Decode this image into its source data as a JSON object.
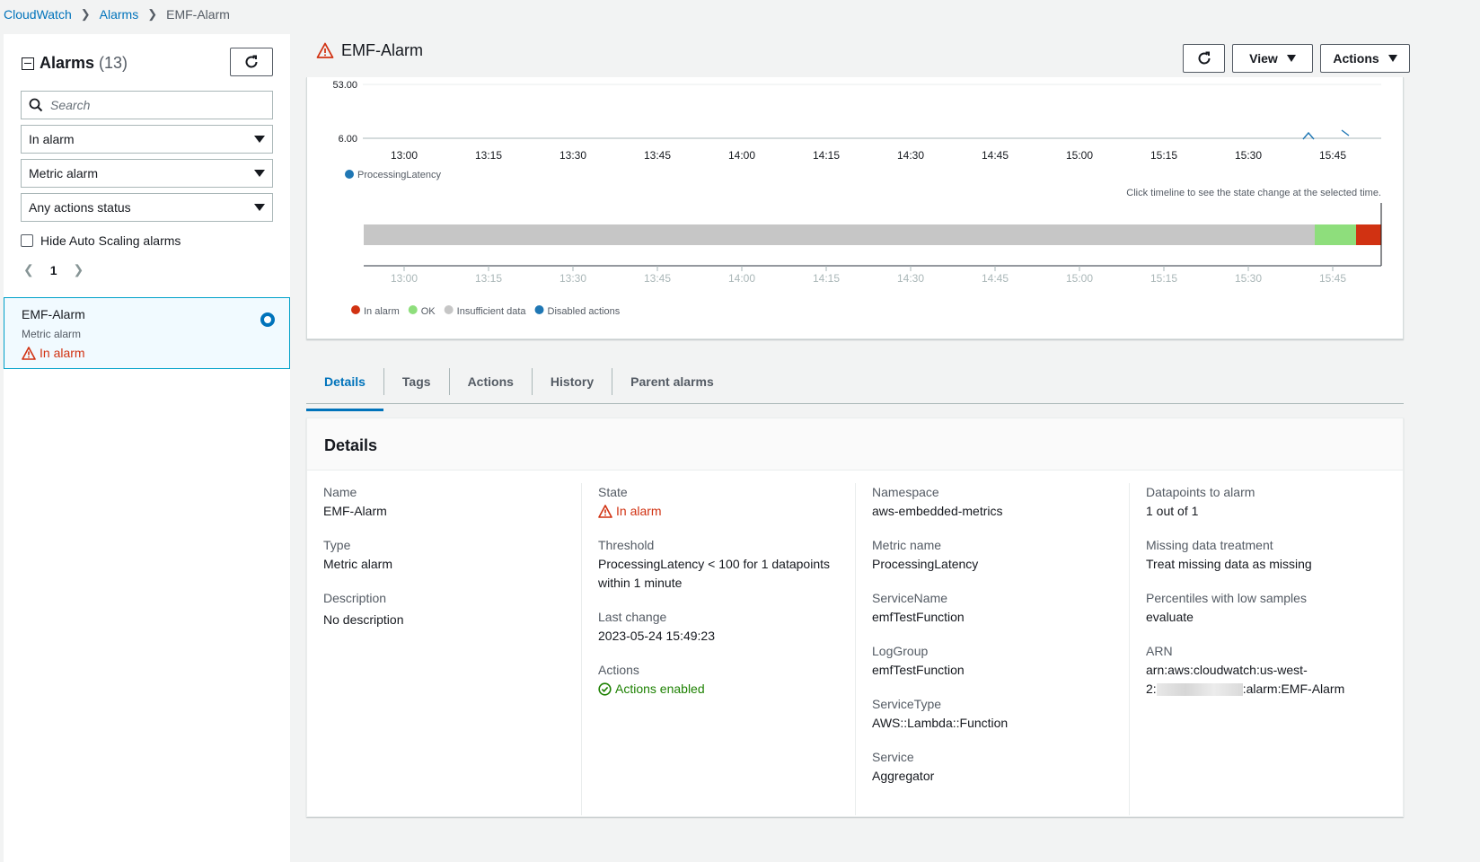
{
  "breadcrumb": {
    "root": "CloudWatch",
    "section": "Alarms",
    "current": "EMF-Alarm"
  },
  "left_panel": {
    "title": "Alarms",
    "count": "(13)",
    "search_placeholder": "Search",
    "filters": [
      "In alarm",
      "Metric alarm",
      "Any actions status"
    ],
    "hide_autoscaling_label": "Hide Auto Scaling alarms",
    "page": "1",
    "alarm": {
      "name": "EMF-Alarm",
      "type": "Metric alarm",
      "state": "In alarm"
    }
  },
  "header": {
    "title": "EMF-Alarm",
    "view_label": "View",
    "actions_label": "Actions"
  },
  "chart_data": {
    "type": "line",
    "y_ticks": [
      "53.00",
      "6.00"
    ],
    "ylim": [
      6,
      53
    ],
    "x_ticks": [
      "13:00",
      "13:15",
      "13:30",
      "13:45",
      "14:00",
      "14:15",
      "14:30",
      "14:45",
      "15:00",
      "15:15",
      "15:30",
      "15:45"
    ],
    "series": [
      {
        "name": "ProcessingLatency",
        "color": "#1f77b4"
      }
    ],
    "timeline_hint": "Click timeline to see the state change at the selected time.",
    "timeline_x_ticks": [
      "13:00",
      "13:15",
      "13:30",
      "13:45",
      "14:00",
      "14:15",
      "14:30",
      "14:45",
      "15:00",
      "15:15",
      "15:30",
      "15:45"
    ],
    "timeline_legend": [
      {
        "label": "In alarm",
        "color": "#d13212"
      },
      {
        "label": "OK",
        "color": "#8ede7c"
      },
      {
        "label": "Insufficient data",
        "color": "#c6c6c6"
      },
      {
        "label": "Disabled actions",
        "color": "#1f77b4"
      }
    ]
  },
  "tabs": [
    "Details",
    "Tags",
    "Actions",
    "History",
    "Parent alarms"
  ],
  "details": {
    "heading": "Details",
    "name_k": "Name",
    "name_v": "EMF-Alarm",
    "type_k": "Type",
    "type_v": "Metric alarm",
    "desc_k": "Description",
    "desc_v": "No description",
    "state_k": "State",
    "state_v": "In alarm",
    "threshold_k": "Threshold",
    "threshold_v1": "ProcessingLatency < 100 for 1 datapoints",
    "threshold_v2": "within 1 minute",
    "lastchange_k": "Last change",
    "lastchange_v": "2023-05-24 15:49:23",
    "actions_k": "Actions",
    "actions_v": "Actions enabled",
    "namespace_k": "Namespace",
    "namespace_v": "aws-embedded-metrics",
    "metric_k": "Metric name",
    "metric_v": "ProcessingLatency",
    "svcname_k": "ServiceName",
    "svcname_v": "emfTestFunction",
    "loggroup_k": "LogGroup",
    "loggroup_v": "emfTestFunction",
    "svctype_k": "ServiceType",
    "svctype_v": "AWS::Lambda::Function",
    "service_k": "Service",
    "service_v": "Aggregator",
    "dp_k": "Datapoints to alarm",
    "dp_v": "1 out of 1",
    "missing_k": "Missing data treatment",
    "missing_v": "Treat missing data as missing",
    "pct_k": "Percentiles with low samples",
    "pct_v": "evaluate",
    "arn_k": "ARN",
    "arn_v1": "arn:aws:cloudwatch:us-west-",
    "arn_v2a": "2:",
    "arn_v2b": ":alarm:EMF-Alarm"
  },
  "colors": {
    "link": "#0073bb",
    "alarm": "#d13212",
    "ok": "#1d8102"
  }
}
